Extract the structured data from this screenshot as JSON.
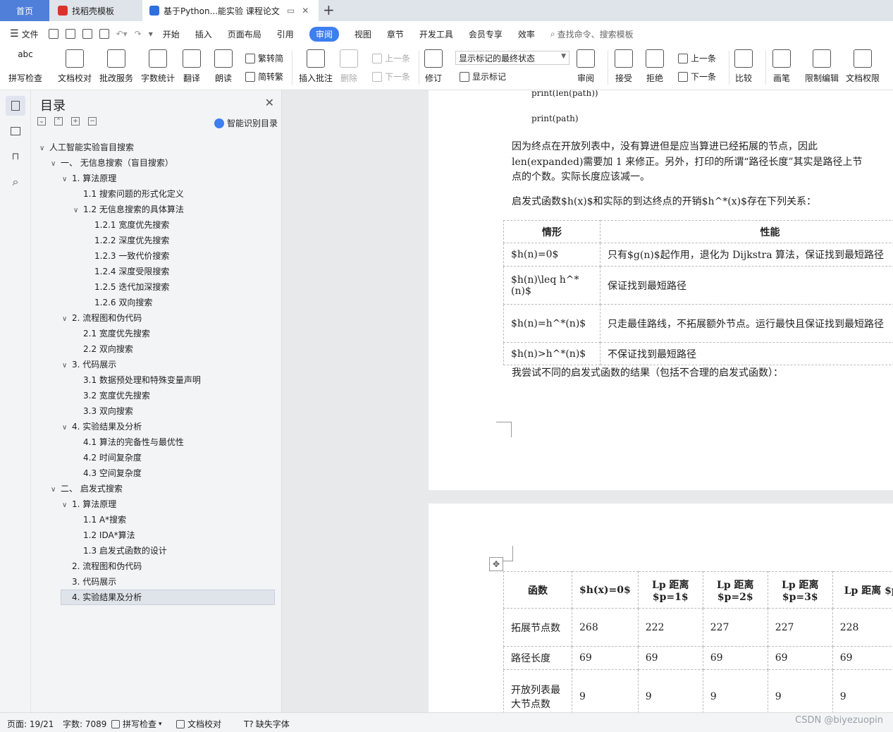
{
  "tabs": {
    "home": "首页",
    "template": "找稻壳模板",
    "document": "基于Python...能实验 课程论文",
    "plus": "+"
  },
  "menu": {
    "file": "文件",
    "items": [
      "开始",
      "插入",
      "页面布局",
      "引用",
      "审阅",
      "视图",
      "章节",
      "开发工具",
      "会员专享",
      "效率"
    ],
    "active": "审阅",
    "search": "查找命令、搜索模板"
  },
  "ribbon": {
    "spell_check": "拼写检查",
    "doc_proofread": "文档校对",
    "batch_service": "批改服务",
    "word_count": "字数统计",
    "translate": "翻译",
    "read_aloud": "朗读",
    "trad_convert": "繁转简",
    "simp_convert": "简转繁",
    "insert_comment": "插入批注",
    "delete": "删除",
    "prev_comment": "上一条",
    "next_comment": "下一条",
    "revise": "修订",
    "markup_state": "显示标记的最终状态",
    "show_markup": "显示标记",
    "review": "审阅",
    "accept": "接受",
    "reject": "拒绝",
    "prev_change": "上一条",
    "next_change": "下一条",
    "compare": "比较",
    "ink": "画笔",
    "restrict_edit": "限制编辑",
    "doc_permission": "文档权限"
  },
  "toc": {
    "title": "目录",
    "smart": "智能识别目录",
    "items": [
      {
        "label": "人工智能实验盲目搜索",
        "level": 0,
        "caret": "v"
      },
      {
        "label": "一、  无信息搜索（盲目搜索）",
        "level": 1,
        "caret": "v"
      },
      {
        "label": "1. 算法原理",
        "level": 2,
        "caret": "v"
      },
      {
        "label": "1.1  搜索问题的形式化定义",
        "level": 3,
        "caret": ""
      },
      {
        "label": "1.2  无信息搜索的具体算法",
        "level": 3,
        "caret": "v"
      },
      {
        "label": "1.2.1  宽度优先搜索",
        "level": 4,
        "caret": ""
      },
      {
        "label": "1.2.2  深度优先搜索",
        "level": 4,
        "caret": ""
      },
      {
        "label": "1.2.3  一致代价搜索",
        "level": 4,
        "caret": ""
      },
      {
        "label": "1.2.4  深度受限搜索",
        "level": 4,
        "caret": ""
      },
      {
        "label": "1.2.5  迭代加深搜索",
        "level": 4,
        "caret": ""
      },
      {
        "label": "1.2.6  双向搜索",
        "level": 4,
        "caret": ""
      },
      {
        "label": "2. 流程图和伪代码",
        "level": 2,
        "caret": "v"
      },
      {
        "label": "2.1  宽度优先搜索",
        "level": 3,
        "caret": ""
      },
      {
        "label": "2.2  双向搜索",
        "level": 3,
        "caret": ""
      },
      {
        "label": "3. 代码展示",
        "level": 2,
        "caret": "v"
      },
      {
        "label": "3.1  数据预处理和特殊变量声明",
        "level": 3,
        "caret": ""
      },
      {
        "label": "3.2  宽度优先搜索",
        "level": 3,
        "caret": ""
      },
      {
        "label": "3.3  双向搜索",
        "level": 3,
        "caret": ""
      },
      {
        "label": "4. 实验结果及分析",
        "level": 2,
        "caret": "v"
      },
      {
        "label": "4.1  算法的完备性与最优性",
        "level": 3,
        "caret": ""
      },
      {
        "label": "4.2  时间复杂度",
        "level": 3,
        "caret": ""
      },
      {
        "label": "4.3  空间复杂度",
        "level": 3,
        "caret": ""
      },
      {
        "label": "二、  启发式搜索",
        "level": 1,
        "caret": "v"
      },
      {
        "label": "1. 算法原理",
        "level": 2,
        "caret": "v"
      },
      {
        "label": "1.1 A*搜索",
        "level": 3,
        "caret": ""
      },
      {
        "label": "1.2 IDA*算法",
        "level": 3,
        "caret": ""
      },
      {
        "label": "1.3  启发式函数的设计",
        "level": 3,
        "caret": ""
      },
      {
        "label": "2. 流程图和伪代码",
        "level": 2,
        "caret": ""
      },
      {
        "label": "3. 代码展示",
        "level": 2,
        "caret": ""
      },
      {
        "label": "4. 实验结果及分析",
        "level": 2,
        "caret": "",
        "selected": true
      }
    ]
  },
  "page1": {
    "code1": "print(len(path))",
    "code2": "print(path)",
    "para1_l1": "因为终点在开放列表中，没有算进但是应当算进已经拓展的节点，因此",
    "para1_l2": "len(expanded)需要加  1  来修正。另外，打印的所谓“路径长度”其实是路径上节",
    "para1_l3": "点的个数。实际长度应该减一。",
    "para2": "启发式函数$h(x)$和实际的到达终点的开销$h^*(x)$存在下列关系：",
    "table_headers": [
      "情形",
      "性能"
    ],
    "table_rows": [
      [
        "$h(n)=0$",
        "只有$g(n)$起作用，退化为 Dijkstra 算法，保证找到最短路径"
      ],
      [
        "$h(n)\\leq h^*(n)$",
        "保证找到最短路径"
      ],
      [
        "$h(n)=h^*(n)$",
        "只走最佳路线，不拓展额外节点。运行最快且保证找到最短路径"
      ],
      [
        "$h(n)>h^*(n)$",
        "不保证找到最短路径"
      ]
    ],
    "para3": "我尝试不同的启发式函数的结果（包括不合理的启发式函数）："
  },
  "page2": {
    "headers": [
      "函数",
      "$h(x)=0$",
      "Lp 距离 $p=1$",
      "Lp 距离 $p=2$",
      "Lp 距离 $p=3$",
      "Lp 距离 $p=\\infin$"
    ],
    "rows": [
      [
        "拓展节点数",
        "268",
        "222",
        "227",
        "227",
        "228"
      ],
      [
        "路径长度",
        "69",
        "69",
        "69",
        "69",
        "69"
      ],
      [
        "开放列表最大节点数",
        "9",
        "9",
        "9",
        "9",
        "9"
      ]
    ]
  },
  "status": {
    "page": "页面: 19/21",
    "words": "字数: 7089",
    "spell": "拼写检查",
    "proof": "文档校对",
    "missing_font": "缺失字体",
    "watermark": "CSDN @biyezuopin"
  },
  "colors": {
    "accent": "#3d7ef0",
    "home_tab": "#4f7fd9",
    "panel_bg": "#f3f4f6",
    "doc_bg": "#e8e9eb"
  }
}
